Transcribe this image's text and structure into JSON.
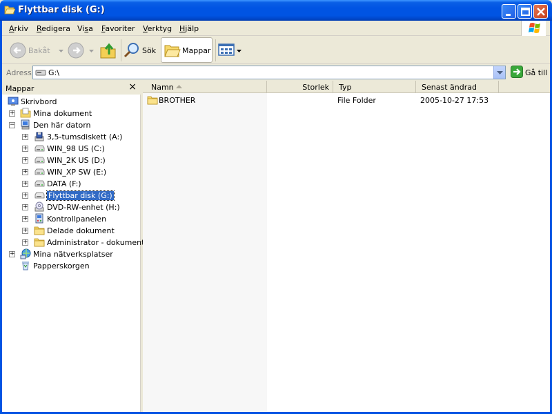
{
  "window": {
    "title": "Flyttbar disk (G:)"
  },
  "menu": {
    "items": [
      {
        "pre": "",
        "accel": "A",
        "post": "rkiv"
      },
      {
        "pre": "",
        "accel": "R",
        "post": "edigera"
      },
      {
        "pre": "Vi",
        "accel": "s",
        "post": "a"
      },
      {
        "pre": "",
        "accel": "F",
        "post": "avoriter"
      },
      {
        "pre": "",
        "accel": "V",
        "post": "erktyg"
      },
      {
        "pre": "",
        "accel": "H",
        "post": "jälp"
      }
    ]
  },
  "toolbar": {
    "back_label": "Bakåt",
    "search_label": "Sök",
    "folders_label": "Mappar"
  },
  "address": {
    "label": "Adress",
    "value": "G:\\",
    "go_label": "Gå till"
  },
  "folders_pane": {
    "title": "Mappar",
    "close": "×",
    "items": [
      {
        "label": "Skrivbord",
        "icon": "desktop-icon",
        "level": 0,
        "expander": "",
        "selected": false
      },
      {
        "label": "Mina dokument",
        "icon": "my-documents-icon",
        "level": 1,
        "expander": "+",
        "selected": false
      },
      {
        "label": "Den här datorn",
        "icon": "my-computer-icon",
        "level": 1,
        "expander": "−",
        "selected": false
      },
      {
        "label": "3,5-tumsdiskett (A:)",
        "icon": "floppy-drive-icon",
        "level": 2,
        "expander": "+",
        "selected": false
      },
      {
        "label": "WIN_98 US (C:)",
        "icon": "hard-drive-icon",
        "level": 2,
        "expander": "+",
        "selected": false
      },
      {
        "label": "WIN_2K US (D:)",
        "icon": "hard-drive-icon",
        "level": 2,
        "expander": "+",
        "selected": false
      },
      {
        "label": "WIN_XP SW (E:)",
        "icon": "hard-drive-icon",
        "level": 2,
        "expander": "+",
        "selected": false
      },
      {
        "label": "DATA (F:)",
        "icon": "hard-drive-icon",
        "level": 2,
        "expander": "+",
        "selected": false
      },
      {
        "label": "Flyttbar disk (G:)",
        "icon": "removable-drive-icon",
        "level": 2,
        "expander": "+",
        "selected": true
      },
      {
        "label": "DVD-RW-enhet (H:)",
        "icon": "dvd-drive-icon",
        "level": 2,
        "expander": "+",
        "selected": false
      },
      {
        "label": "Kontrollpanelen",
        "icon": "control-panel-icon",
        "level": 2,
        "expander": "+",
        "selected": false
      },
      {
        "label": "Delade dokument",
        "icon": "folder-icon",
        "level": 2,
        "expander": "+",
        "selected": false
      },
      {
        "label": "Administrator - dokument",
        "icon": "folder-icon",
        "level": 2,
        "expander": "+",
        "selected": false
      },
      {
        "label": "Mina nätverksplatser",
        "icon": "network-places-icon",
        "level": 1,
        "expander": "+",
        "selected": false
      },
      {
        "label": "Papperskorgen",
        "icon": "recycle-bin-icon",
        "level": 1,
        "expander": "",
        "selected": false
      }
    ]
  },
  "file_list": {
    "columns": [
      "Namn",
      "Storlek",
      "Typ",
      "Senast ändrad"
    ],
    "rows": [
      {
        "name": "BROTHER",
        "size": "",
        "type": "File Folder",
        "modified": "2005-10-27 17:53"
      }
    ]
  },
  "colors": {
    "titlebar": "#0054e3",
    "selection": "#316ac5",
    "chrome": "#ece9d8"
  }
}
